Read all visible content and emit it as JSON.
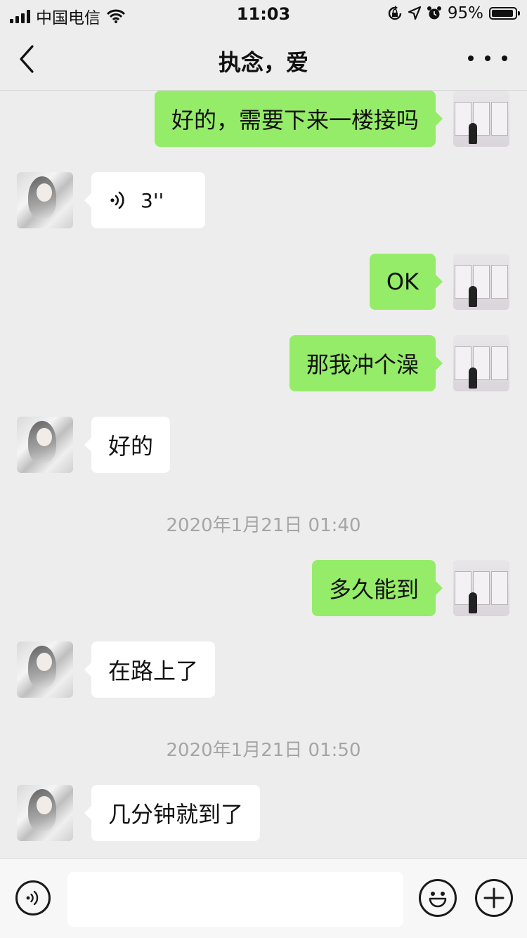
{
  "status_bar": {
    "carrier": "中国电信",
    "time": "11:03",
    "battery_percent": "95%",
    "battery_level": 0.95,
    "icons": [
      "signal-icon",
      "wifi-icon",
      "screen-lock-icon",
      "location-icon",
      "alarm-icon",
      "battery-icon"
    ]
  },
  "nav": {
    "title": "执念，爱",
    "back_icon": "chevron-left-icon",
    "more_icon": "more-dots-icon"
  },
  "messages": [
    {
      "side": "right",
      "type": "text",
      "text": "好的，需要下来一楼接吗"
    },
    {
      "side": "left",
      "type": "voice",
      "duration": "3''"
    },
    {
      "side": "right",
      "type": "text",
      "text": "OK"
    },
    {
      "side": "right",
      "type": "text",
      "text": "那我冲个澡"
    },
    {
      "side": "left",
      "type": "text",
      "text": "好的"
    },
    {
      "type": "timestamp",
      "text": "2020年1月21日 01:40"
    },
    {
      "side": "right",
      "type": "text",
      "text": "多久能到"
    },
    {
      "side": "left",
      "type": "text",
      "text": "在路上了"
    },
    {
      "type": "timestamp",
      "text": "2020年1月21日 01:50"
    },
    {
      "side": "left",
      "type": "text",
      "text": "几分钟就到了"
    }
  ],
  "input_bar": {
    "voice_icon": "voice-mode-icon",
    "emoji_icon": "emoji-icon",
    "plus_icon": "plus-icon",
    "text_value": ""
  },
  "colors": {
    "background": "#ededed",
    "self_bubble": "#95ec69",
    "other_bubble": "#ffffff",
    "timestamp_text": "#a5a5a5"
  }
}
